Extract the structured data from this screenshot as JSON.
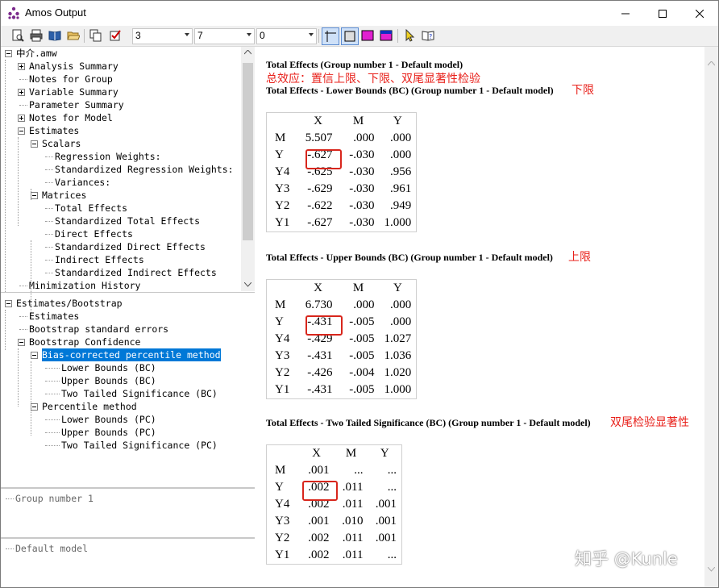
{
  "window": {
    "title": "Amos Output"
  },
  "toolbar": {
    "icons": [
      "print-preview-icon",
      "print-icon",
      "book-icon",
      "open-folder-icon",
      "copy-icon",
      "checkbox-icon",
      "crosshair-icon",
      "square-icon",
      "magenta-box-icon",
      "magenta-blue-box-icon",
      "pointer-icon",
      "help-book-icon"
    ],
    "combos": [
      {
        "value": "3"
      },
      {
        "value": "7"
      },
      {
        "value": "0"
      }
    ]
  },
  "tree": {
    "root": "中介.amw",
    "items": [
      "Analysis Summary",
      "Notes for Group",
      "Variable Summary",
      "Parameter Summary",
      "Notes for Model",
      "Estimates",
      "Scalars",
      "Regression Weights:",
      "Standardized Regression Weights:",
      "Variances:",
      "Matrices",
      "Total Effects",
      "Standardized Total Effects",
      "Direct Effects",
      "Standardized Direct Effects",
      "Indirect Effects",
      "Standardized Indirect Effects",
      "Minimization History"
    ],
    "boot": [
      "Estimates/Bootstrap",
      "Estimates",
      "Bootstrap standard errors",
      "Bootstrap Confidence",
      "Bias-corrected percentile method",
      "Lower Bounds (BC)",
      "Upper Bounds (BC)",
      "Two Tailed Significance (BC)",
      "Percentile method",
      "Lower Bounds (PC)",
      "Upper Bounds (PC)",
      "Two Tailed Significance (PC)"
    ],
    "group": "Group number 1",
    "model": "Default model"
  },
  "output": {
    "heading1": "Total Effects (Group number 1 - Default model)",
    "note1": "总效应：置信上限、下限、双尾显著性检验",
    "sections": [
      {
        "heading": "Total Effects - Lower Bounds (BC) (Group number 1 - Default model)",
        "note": "下限",
        "cols": [
          "X",
          "M",
          "Y"
        ],
        "rows": [
          {
            "label": "M",
            "vals": [
              "5.507",
              ".000",
              ".000"
            ]
          },
          {
            "label": "Y",
            "vals": [
              "-.627",
              "-.030",
              ".000"
            ]
          },
          {
            "label": "Y4",
            "vals": [
              "-.625",
              "-.030",
              ".956"
            ]
          },
          {
            "label": "Y3",
            "vals": [
              "-.629",
              "-.030",
              ".961"
            ]
          },
          {
            "label": "Y2",
            "vals": [
              "-.622",
              "-.030",
              ".949"
            ]
          },
          {
            "label": "Y1",
            "vals": [
              "-.627",
              "-.030",
              "1.000"
            ]
          }
        ]
      },
      {
        "heading": "Total Effects - Upper Bounds (BC) (Group number 1 - Default model)",
        "note": "上限",
        "cols": [
          "X",
          "M",
          "Y"
        ],
        "rows": [
          {
            "label": "M",
            "vals": [
              "6.730",
              ".000",
              ".000"
            ]
          },
          {
            "label": "Y",
            "vals": [
              "-.431",
              "-.005",
              ".000"
            ]
          },
          {
            "label": "Y4",
            "vals": [
              "-.429",
              "-.005",
              "1.027"
            ]
          },
          {
            "label": "Y3",
            "vals": [
              "-.431",
              "-.005",
              "1.036"
            ]
          },
          {
            "label": "Y2",
            "vals": [
              "-.426",
              "-.004",
              "1.020"
            ]
          },
          {
            "label": "Y1",
            "vals": [
              "-.431",
              "-.005",
              "1.000"
            ]
          }
        ]
      },
      {
        "heading": "Total Effects - Two Tailed Significance (BC) (Group number 1 - Default model)",
        "note": "双尾检验显著性",
        "cols": [
          "X",
          "M",
          "Y"
        ],
        "rows": [
          {
            "label": "M",
            "vals": [
              ".001",
              "...",
              "..."
            ]
          },
          {
            "label": "Y",
            "vals": [
              ".002",
              ".011",
              "..."
            ]
          },
          {
            "label": "Y4",
            "vals": [
              ".002",
              ".011",
              ".001"
            ]
          },
          {
            "label": "Y3",
            "vals": [
              ".001",
              ".010",
              ".001"
            ]
          },
          {
            "label": "Y2",
            "vals": [
              ".002",
              ".011",
              ".001"
            ]
          },
          {
            "label": "Y1",
            "vals": [
              ".002",
              ".011",
              "..."
            ]
          }
        ]
      }
    ]
  },
  "watermark": "知乎 @Kunle",
  "colors": {
    "annotation": "#e8211b",
    "selection": "#0078d7"
  }
}
